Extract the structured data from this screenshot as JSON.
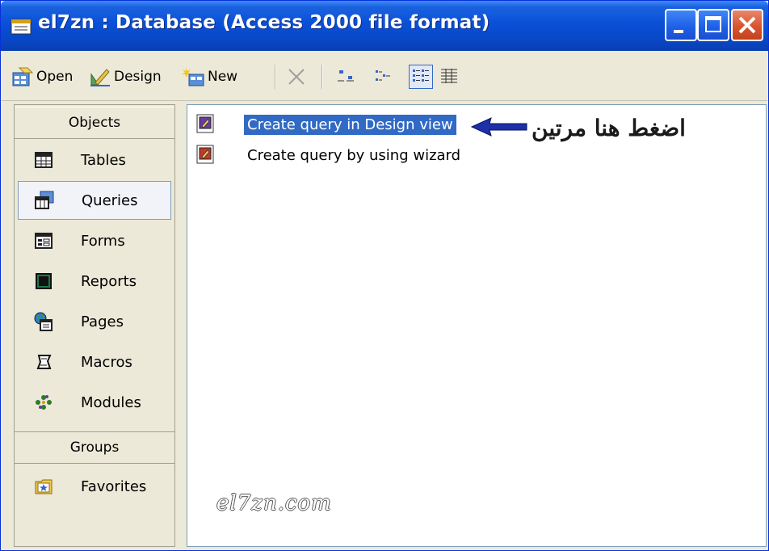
{
  "window": {
    "title": "el7zn : Database (Access 2000 file format)"
  },
  "toolbar": {
    "open_label": "Open",
    "design_label": "Design",
    "new_label": "New"
  },
  "objects_bar": {
    "objects_header": "Objects",
    "items": [
      {
        "label": "Tables",
        "icon": "table-icon"
      },
      {
        "label": "Queries",
        "icon": "query-icon",
        "selected": true
      },
      {
        "label": "Forms",
        "icon": "form-icon"
      },
      {
        "label": "Reports",
        "icon": "report-icon"
      },
      {
        "label": "Pages",
        "icon": "page-icon"
      },
      {
        "label": "Macros",
        "icon": "macro-icon"
      },
      {
        "label": "Modules",
        "icon": "module-icon"
      }
    ],
    "groups_header": "Groups",
    "groups": [
      {
        "label": "Favorites",
        "icon": "favorites-folder-icon"
      }
    ]
  },
  "list": {
    "items": [
      {
        "label": "Create query in Design view",
        "selected": true
      },
      {
        "label": "Create query by using wizard",
        "selected": false
      }
    ]
  },
  "annotation": {
    "text": "اضغط هنا مرتين"
  },
  "watermark": {
    "text": "el7zn.com"
  },
  "colors": {
    "titlebar": "#0a50d8",
    "selection": "#316ac5",
    "close_button": "#d8542f"
  }
}
